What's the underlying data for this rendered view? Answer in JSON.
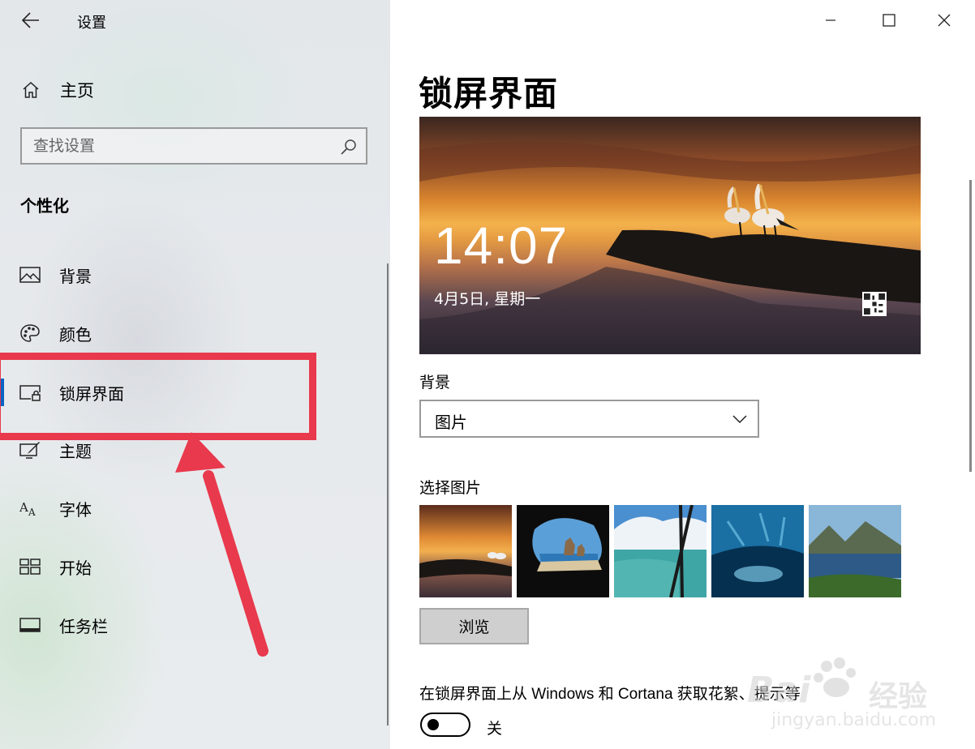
{
  "window": {
    "title": "设置",
    "minimize_icon": "minimize-icon",
    "maximize_icon": "maximize-icon",
    "close_icon": "close-icon"
  },
  "sidebar": {
    "home_label": "主页",
    "search_placeholder": "查找设置",
    "section_title": "个性化",
    "items": [
      {
        "label": "背景",
        "icon": "picture-icon"
      },
      {
        "label": "颜色",
        "icon": "palette-icon"
      },
      {
        "label": "锁屏界面",
        "icon": "lock-screen-icon",
        "active": true
      },
      {
        "label": "主题",
        "icon": "theme-brush-icon"
      },
      {
        "label": "字体",
        "icon": "font-icon"
      },
      {
        "label": "开始",
        "icon": "start-tiles-icon"
      },
      {
        "label": "任务栏",
        "icon": "taskbar-icon"
      }
    ]
  },
  "main": {
    "page_title": "锁屏界面",
    "preview": {
      "time": "14:07",
      "date": "4月5日, 星期一"
    },
    "background_label": "背景",
    "background_value": "图片",
    "choose_picture_label": "选择图片",
    "browse_label": "浏览",
    "tips_label": "在锁屏界面上从 Windows 和 Cortana 获取花絮、提示等",
    "tips_toggle_state": "关"
  },
  "watermark": {
    "brand": "Bai",
    "brand_suffix": "经验",
    "url": "jingyan.baidu.com"
  },
  "colors": {
    "accent": "#0a63c4",
    "annotation_red": "#e8394d"
  }
}
